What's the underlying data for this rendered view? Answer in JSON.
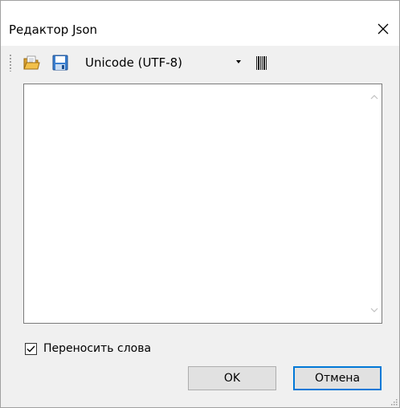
{
  "window": {
    "title": "Редактор Json",
    "close_icon": "close-icon"
  },
  "toolbar": {
    "open_icon": "open-folder-icon",
    "save_icon": "save-disk-icon",
    "encoding": {
      "selected": "Unicode (UTF-8)"
    },
    "barcode_icon": "barcode-icon"
  },
  "editor": {
    "content": ""
  },
  "options": {
    "word_wrap_label": "Переносить слова",
    "word_wrap_checked": true
  },
  "buttons": {
    "ok_label": "OK",
    "cancel_label": "Отмена"
  },
  "colors": {
    "accent": "#0078d7",
    "dialog_bg": "#f0f0f0",
    "button_bg": "#e1e1e1"
  }
}
